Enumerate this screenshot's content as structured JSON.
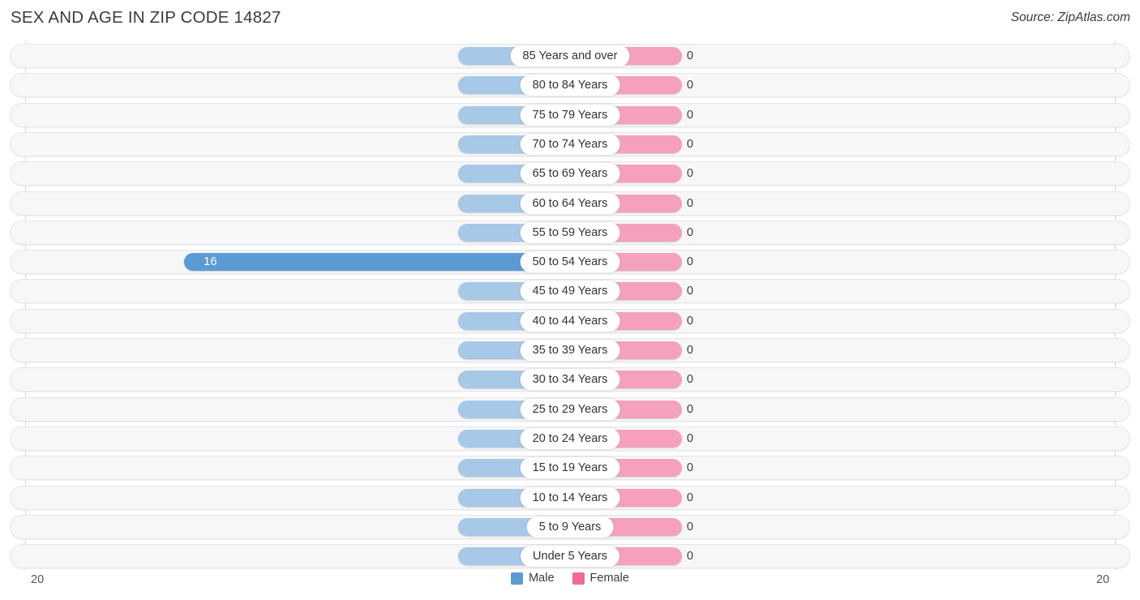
{
  "header": {
    "title": "SEX AND AGE IN ZIP CODE 14827",
    "source": "Source: ZipAtlas.com"
  },
  "legend": {
    "male_label": "Male",
    "female_label": "Female",
    "male_color": "#5b9bd5",
    "female_color": "#f2699c"
  },
  "axis": {
    "left_tick": "20",
    "right_tick": "20"
  },
  "colors": {
    "bar_male_default": "#a8c8e8",
    "bar_male_highlight": "#5b9bd5",
    "bar_female": "#f5a0bc",
    "row_track": "#f7f7f7",
    "gridline": "#d9d9d9"
  },
  "chart_data": {
    "type": "bar",
    "title": "SEX AND AGE IN ZIP CODE 14827",
    "subtitle": "Source: ZipAtlas.com",
    "orientation": "horizontal",
    "layout": "diverging-population-pyramid",
    "xlabel": "",
    "ylabel": "",
    "xlim": [
      20,
      20
    ],
    "axis_left_max": 20,
    "axis_right_max": 20,
    "grid": true,
    "legend_position": "bottom-center",
    "categories": [
      "85 Years and over",
      "80 to 84 Years",
      "75 to 79 Years",
      "70 to 74 Years",
      "65 to 69 Years",
      "60 to 64 Years",
      "55 to 59 Years",
      "50 to 54 Years",
      "45 to 49 Years",
      "40 to 44 Years",
      "35 to 39 Years",
      "30 to 34 Years",
      "25 to 29 Years",
      "20 to 24 Years",
      "15 to 19 Years",
      "10 to 14 Years",
      "5 to 9 Years",
      "Under 5 Years"
    ],
    "series": [
      {
        "name": "Male",
        "side": "left",
        "color": "#5b9bd5",
        "values": [
          0,
          0,
          0,
          0,
          0,
          0,
          0,
          16,
          0,
          0,
          0,
          0,
          0,
          0,
          0,
          0,
          0,
          0
        ]
      },
      {
        "name": "Female",
        "side": "right",
        "color": "#f2699c",
        "values": [
          0,
          0,
          0,
          0,
          0,
          0,
          0,
          0,
          0,
          0,
          0,
          0,
          0,
          0,
          0,
          0,
          0,
          0
        ]
      }
    ]
  },
  "rows": [
    {
      "label": "85 Years and over",
      "male": "0",
      "female": "0"
    },
    {
      "label": "80 to 84 Years",
      "male": "0",
      "female": "0"
    },
    {
      "label": "75 to 79 Years",
      "male": "0",
      "female": "0"
    },
    {
      "label": "70 to 74 Years",
      "male": "0",
      "female": "0"
    },
    {
      "label": "65 to 69 Years",
      "male": "0",
      "female": "0"
    },
    {
      "label": "60 to 64 Years",
      "male": "0",
      "female": "0"
    },
    {
      "label": "55 to 59 Years",
      "male": "0",
      "female": "0"
    },
    {
      "label": "50 to 54 Years",
      "male": "16",
      "female": "0"
    },
    {
      "label": "45 to 49 Years",
      "male": "0",
      "female": "0"
    },
    {
      "label": "40 to 44 Years",
      "male": "0",
      "female": "0"
    },
    {
      "label": "35 to 39 Years",
      "male": "0",
      "female": "0"
    },
    {
      "label": "30 to 34 Years",
      "male": "0",
      "female": "0"
    },
    {
      "label": "25 to 29 Years",
      "male": "0",
      "female": "0"
    },
    {
      "label": "20 to 24 Years",
      "male": "0",
      "female": "0"
    },
    {
      "label": "15 to 19 Years",
      "male": "0",
      "female": "0"
    },
    {
      "label": "10 to 14 Years",
      "male": "0",
      "female": "0"
    },
    {
      "label": "5 to 9 Years",
      "male": "0",
      "female": "0"
    },
    {
      "label": "Under 5 Years",
      "male": "0",
      "female": "0"
    }
  ]
}
